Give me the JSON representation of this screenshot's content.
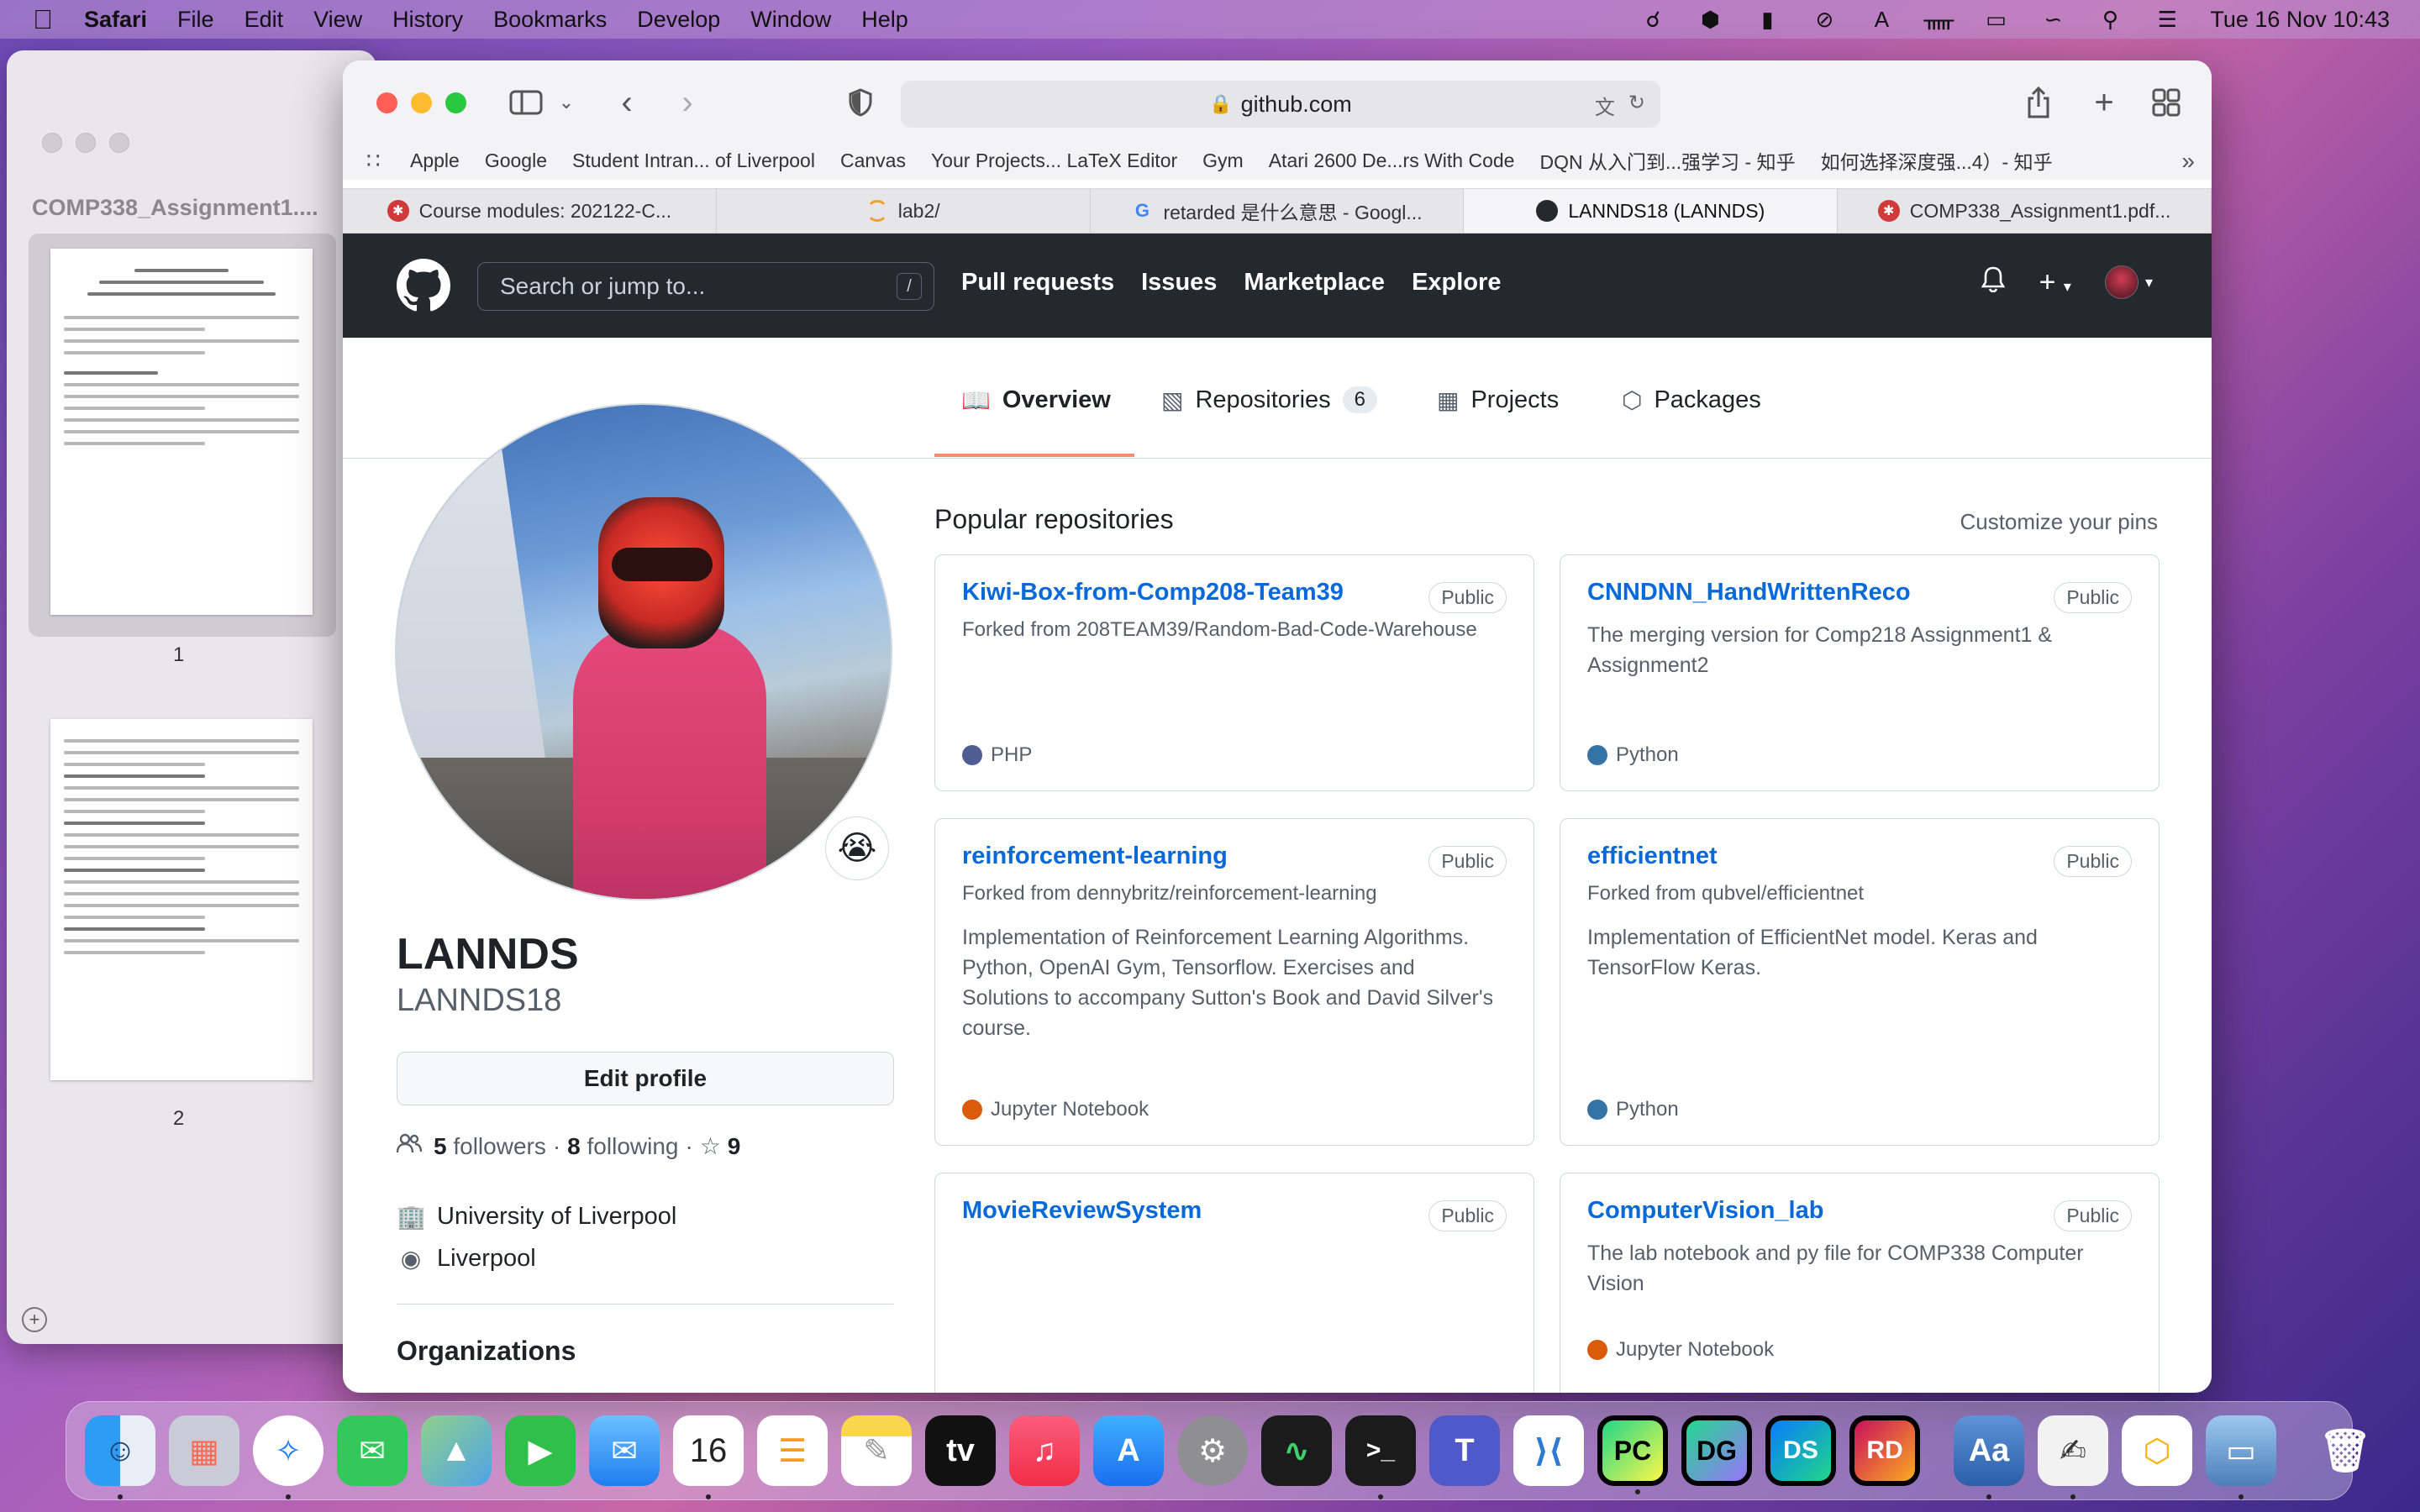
{
  "menubar": {
    "app": "Safari",
    "items": [
      "File",
      "Edit",
      "View",
      "History",
      "Bookmarks",
      "Develop",
      "Window",
      "Help"
    ],
    "clock": "Tue 16 Nov  10:43"
  },
  "preview": {
    "title": "COMP338_Assignment1....",
    "pages": [
      "1",
      "2"
    ]
  },
  "safari": {
    "address": "github.com",
    "bookmarks": [
      "Apple",
      "Google",
      "Student Intran... of Liverpool",
      "Canvas",
      "Your Projects... LaTeX Editor",
      "Gym",
      "Atari 2600 De...rs With Code",
      "DQN 从入门到...强学习 - 知乎",
      "如何选择深度强...4）- 知乎"
    ],
    "tabs": [
      {
        "label": "Course modules: 202122-C...",
        "icon_color": "#d03a3a"
      },
      {
        "label": "lab2/",
        "icon_color": "#f0a030"
      },
      {
        "label": "retarded 是什么意思 - Googl...",
        "icon_color": "#4285f4"
      },
      {
        "label": "LANNDS18 (LANNDS)",
        "icon_color": "#24292f"
      },
      {
        "label": "COMP338_Assignment1.pdf...",
        "icon_color": "#d03a3a"
      }
    ]
  },
  "github": {
    "search_placeholder": "Search or jump to...",
    "search_key": "/",
    "nav": [
      "Pull requests",
      "Issues",
      "Marketplace",
      "Explore"
    ],
    "profile_tabs": {
      "overview": "Overview",
      "repositories": "Repositories",
      "repositories_count": "6",
      "projects": "Projects",
      "packages": "Packages"
    },
    "profile": {
      "name": "LANNDS",
      "login": "LANNDS18",
      "status_emoji": "😭",
      "edit_label": "Edit profile",
      "followers_count": "5",
      "followers_label": "followers",
      "following_count": "8",
      "following_label": "following",
      "stars_count": "9",
      "organization": "University of Liverpool",
      "location": "Liverpool",
      "organizations_title": "Organizations"
    },
    "popular_title": "Popular repositories",
    "customize_label": "Customize your pins",
    "repos": [
      {
        "name": "Kiwi-Box-from-Comp208-Team39",
        "visibility": "Public",
        "fork": "Forked from 208TEAM39/Random-Bad-Code-Warehouse",
        "desc": "",
        "language": "PHP",
        "lang_color": "#4F5D95"
      },
      {
        "name": "CNNDNN_HandWrittenReco",
        "visibility": "Public",
        "fork": "",
        "desc": "The merging version for Comp218 Assignment1 & Assignment2",
        "language": "Python",
        "lang_color": "#3572A5"
      },
      {
        "name": "reinforcement-learning",
        "visibility": "Public",
        "fork": "Forked from dennybritz/reinforcement-learning",
        "desc": "Implementation of Reinforcement Learning Algorithms. Python, OpenAI Gym, Tensorflow. Exercises and Solutions to accompany Sutton's Book and David Silver's course.",
        "language": "Jupyter Notebook",
        "lang_color": "#DA5B0B"
      },
      {
        "name": "efficientnet",
        "visibility": "Public",
        "fork": "Forked from qubvel/efficientnet",
        "desc": "Implementation of EfficientNet model. Keras and TensorFlow Keras.",
        "language": "Python",
        "lang_color": "#3572A5"
      },
      {
        "name": "MovieReviewSystem",
        "visibility": "Public",
        "fork": "",
        "desc": "",
        "language": "",
        "lang_color": ""
      },
      {
        "name": "ComputerVision_lab",
        "visibility": "Public",
        "fork": "",
        "desc": "The lab notebook and py file for COMP338 Computer Vision",
        "language": "Jupyter Notebook",
        "lang_color": "#DA5B0B"
      }
    ]
  },
  "dock": {
    "apps": [
      {
        "name": "Finder",
        "glyph": "☺",
        "color": "#2a8cf0"
      },
      {
        "name": "Launchpad",
        "glyph": "▦",
        "color": "#8a8fa0"
      },
      {
        "name": "Safari",
        "glyph": "✧",
        "color": "#1e7cf0"
      },
      {
        "name": "Messages",
        "glyph": "✉",
        "color": "#34c759"
      },
      {
        "name": "Maps",
        "glyph": "▲",
        "color": "#4fb35a"
      },
      {
        "name": "FaceTime",
        "glyph": "▶",
        "color": "#2fbf4a"
      },
      {
        "name": "Mail",
        "glyph": "✉",
        "color": "#2f88f0"
      },
      {
        "name": "Calendar",
        "glyph": "16",
        "color": "#ffffff"
      },
      {
        "name": "Reminders",
        "glyph": "☰",
        "color": "#ffffff"
      },
      {
        "name": "Notes",
        "glyph": "✎",
        "color": "#fbd54c"
      },
      {
        "name": "TV",
        "glyph": "tv",
        "color": "#111111"
      },
      {
        "name": "Music",
        "glyph": "♫",
        "color": "#fb3a4e"
      },
      {
        "name": "App Store",
        "glyph": "A",
        "color": "#1a8cf2"
      },
      {
        "name": "System Preferences",
        "glyph": "⚙",
        "color": "#8e8e93"
      },
      {
        "name": "Activity Monitor",
        "glyph": "∿",
        "color": "#1b1b1b"
      },
      {
        "name": "Terminal",
        "glyph": ">_",
        "color": "#1b1b1b"
      },
      {
        "name": "Teams",
        "glyph": "T",
        "color": "#5059c9"
      },
      {
        "name": "VS Code",
        "glyph": "⟩⟨",
        "color": "#2c7bd1"
      },
      {
        "name": "PyCharm",
        "glyph": "PC",
        "color": "#21d789"
      },
      {
        "name": "DataGrip",
        "glyph": "DG",
        "color": "#22d88f"
      },
      {
        "name": "DataSpell EAP",
        "glyph": "DS",
        "color": "#1a9ed8"
      },
      {
        "name": "Rider EAP",
        "glyph": "RD",
        "color": "#c90f5e"
      },
      {
        "name": "Dictionary",
        "glyph": "Aa",
        "color": "#3a76c4"
      },
      {
        "name": "TextEdit",
        "glyph": "✍",
        "color": "#f2f2f2"
      },
      {
        "name": "Preview Security",
        "glyph": "⬡",
        "color": "#f5b400"
      },
      {
        "name": "Preview",
        "glyph": "▭",
        "color": "#6a9ac8"
      },
      {
        "name": "Trash",
        "glyph": "🗑",
        "color": "#d9dde2"
      }
    ]
  }
}
